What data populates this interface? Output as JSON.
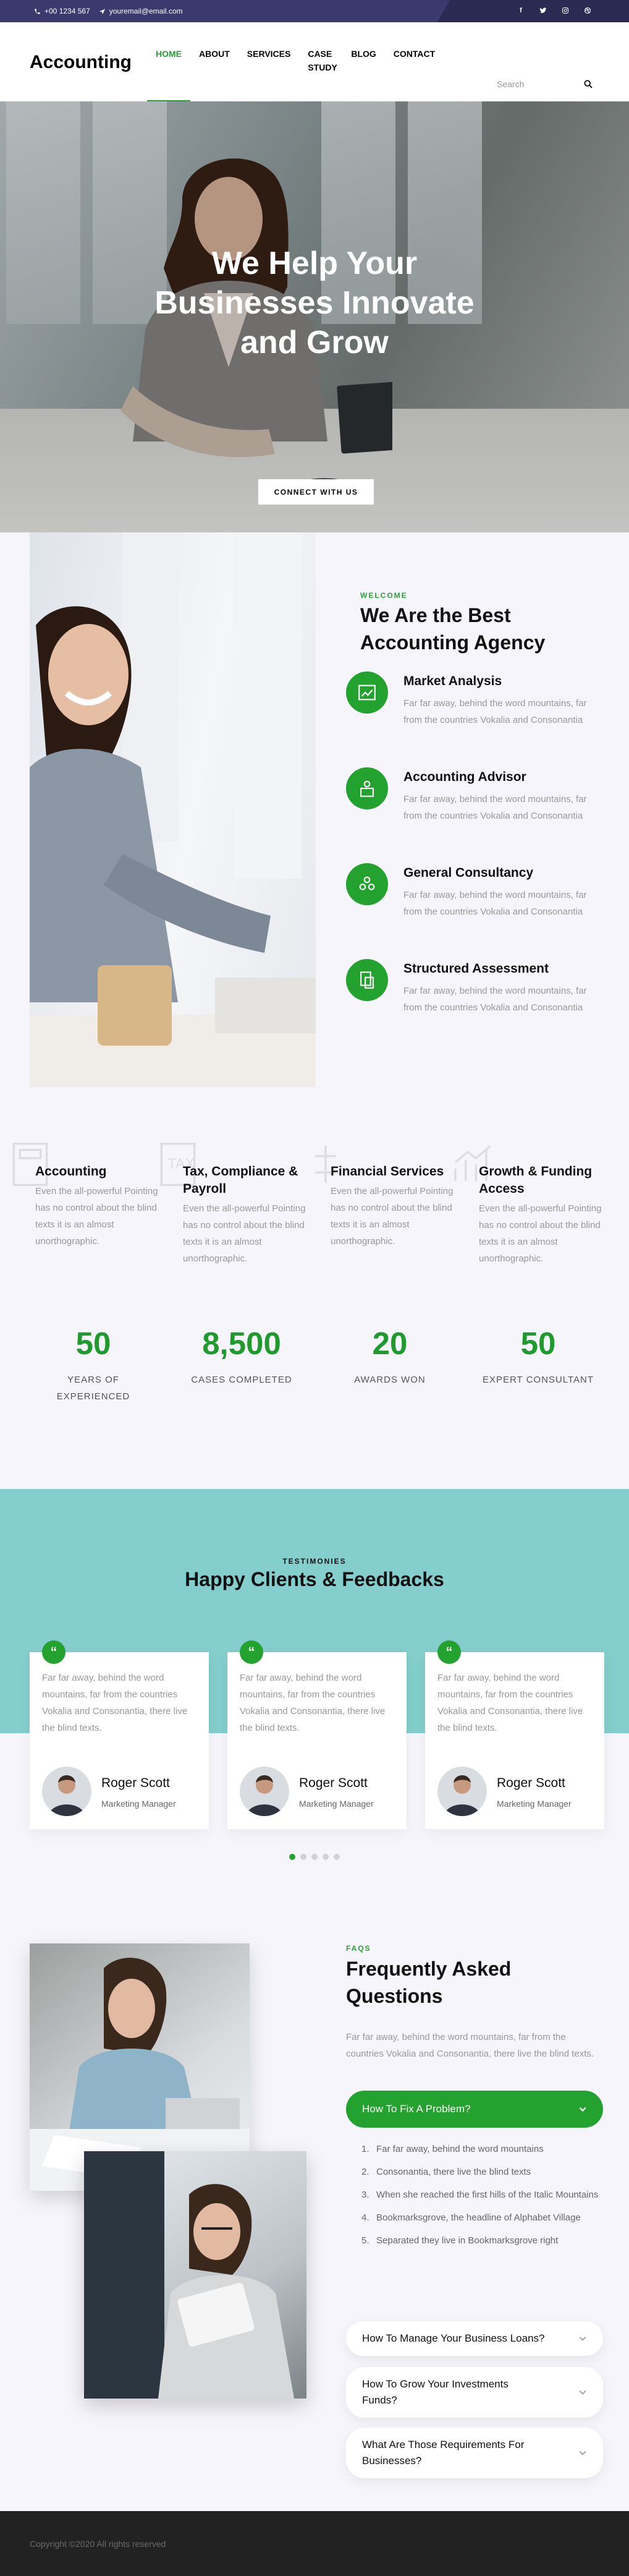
{
  "topbar": {
    "phone": "+00 1234 567",
    "email": "youremail@email.com",
    "social": [
      "facebook-icon",
      "twitter-icon",
      "instagram-icon",
      "dribbble-icon"
    ]
  },
  "nav": {
    "brand": "Accounting",
    "items": [
      {
        "label": "HOME",
        "active": true
      },
      {
        "label": "ABOUT"
      },
      {
        "label": "SERVICES"
      },
      {
        "label": "CASE STUDY"
      },
      {
        "label": "BLOG"
      },
      {
        "label": "CONTACT"
      }
    ],
    "search_placeholder": "Search"
  },
  "hero": {
    "title": "We Help Your Businesses Innovate and Grow",
    "button": "CONNECT WITH US"
  },
  "about": {
    "eyebrow": "WELCOME",
    "title": "We Are the Best Accounting Agency",
    "features": [
      {
        "title": "Market Analysis",
        "text": "Far far away, behind the word mountains, far from the countries Vokalia and Consonantia",
        "icon": "market-analysis-icon"
      },
      {
        "title": "Accounting Advisor",
        "text": "Far far away, behind the word mountains, far from the countries Vokalia and Consonantia",
        "icon": "advisor-icon"
      },
      {
        "title": "General Consultancy",
        "text": "Far far away, behind the word mountains, far from the countries Vokalia and Consonantia",
        "icon": "consultancy-icon"
      },
      {
        "title": "Structured Assessment",
        "text": "Far far away, behind the word mountains, far from the countries Vokalia and Consonantia",
        "icon": "assessment-icon"
      }
    ]
  },
  "services": [
    {
      "title": "Accounting",
      "text": "Even the all-powerful Pointing has no control about the blind texts it is an almost unorthographic."
    },
    {
      "title": "Tax, Compliance & Payroll",
      "text": "Even the all-powerful Pointing has no control about the blind texts it is an almost unorthographic."
    },
    {
      "title": "Financial Services",
      "text": "Even the all-powerful Pointing has no control about the blind texts it is an almost unorthographic."
    },
    {
      "title": "Growth & Funding Access",
      "text": "Even the all-powerful Pointing has no control about the blind texts it is an almost unorthographic."
    }
  ],
  "counters": [
    {
      "value": "50",
      "label": "YEARS OF EXPERIENCED"
    },
    {
      "value": "8,500",
      "label": "CASES COMPLETED"
    },
    {
      "value": "20",
      "label": "AWARDS WON"
    },
    {
      "value": "50",
      "label": "EXPERT CONSULTANT"
    }
  ],
  "testimonials": {
    "eyebrow": "TESTIMONIES",
    "title": "Happy Clients & Feedbacks",
    "cards": [
      {
        "text": "Far far away, behind the word mountains, far from the countries Vokalia and Consonantia, there live the blind texts.",
        "name": "Roger Scott",
        "role": "Marketing Manager"
      },
      {
        "text": "Far far away, behind the word mountains, far from the countries Vokalia and Consonantia, there live the blind texts.",
        "name": "Roger Scott",
        "role": "Marketing Manager"
      },
      {
        "text": "Far far away, behind the word mountains, far from the countries Vokalia and Consonantia, there live the blind texts.",
        "name": "Roger Scott",
        "role": "Marketing Manager"
      }
    ],
    "quote_glyph": "“"
  },
  "faq": {
    "eyebrow": "FAQS",
    "title": "Frequently Asked Questions",
    "description": "Far far away, behind the word mountains, far from the countries Vokalia and Consonantia, there live the blind texts.",
    "open": {
      "question": "How To Fix A Problem?",
      "answers": [
        "Far far away, behind the word mountains",
        "Consonantia, there live the blind texts",
        "When she reached the first hills of the Italic Mountains",
        "Bookmarksgrove, the headline of Alphabet Village",
        "Separated they live in Bookmarksgrove right"
      ]
    },
    "collapsed": [
      "How To Manage Your Business Loans?",
      "How To Grow Your Investments Funds?",
      "What Are Those Requirements For Businesses?"
    ]
  },
  "footer": {
    "copyright": "Copyright ©2020 All rights reserved"
  },
  "colors": {
    "accent": "#24a22f",
    "topbar": "#3a3a6e",
    "teal_band": "#84cece",
    "footer": "#222222"
  }
}
